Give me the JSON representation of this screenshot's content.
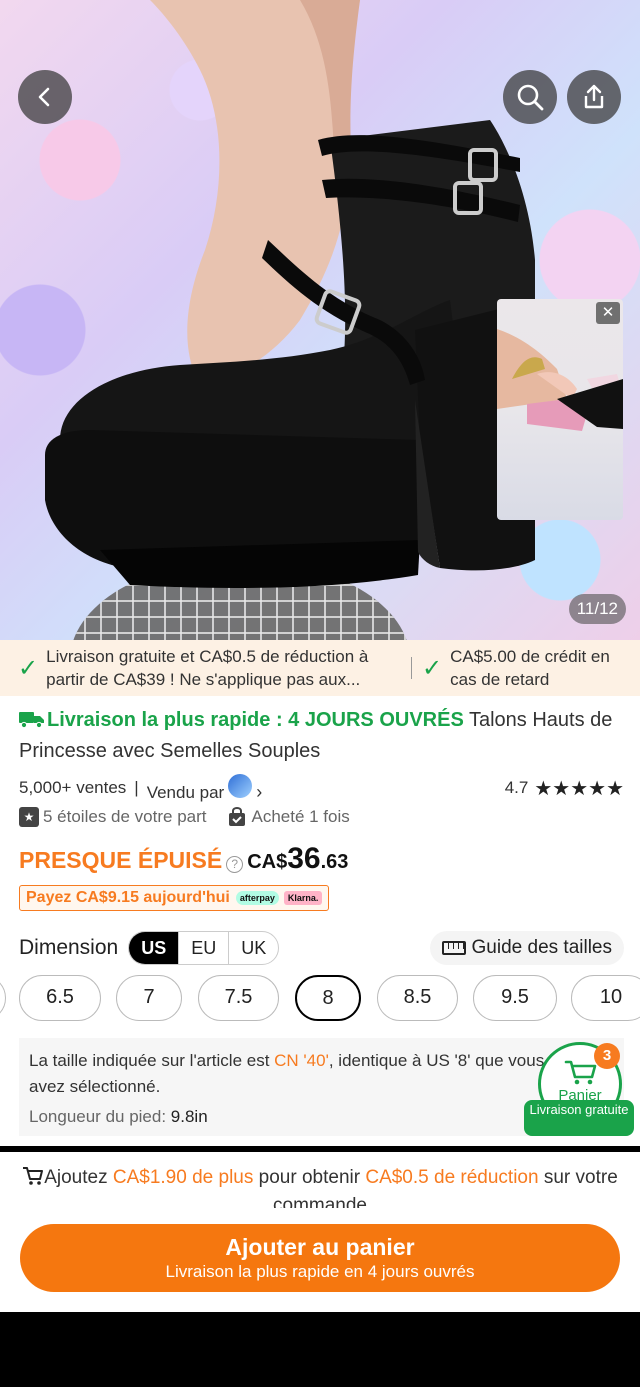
{
  "gallery": {
    "counter": "11/12",
    "icons": {
      "back": "chevron-left-icon",
      "search": "search-icon",
      "share": "share-icon",
      "close": "close-icon"
    }
  },
  "promo": {
    "item1": "Livraison gratuite et CA$0.5 de réduction à partir de CA$39 ! Ne s'applique pas aux...",
    "item2": "CA$5.00 de crédit en cas de retard"
  },
  "product": {
    "fast_delivery": "Livraison la plus rapide : 4 JOURS OUVRÉS",
    "title": " Talons Hauts de Princesse avec Semelles Souples",
    "sales": "5,000+ ventes",
    "sold_by": "Vendu par",
    "rating": "4.7",
    "stars": "★★★★★",
    "badge1": "5 étoiles de votre part",
    "badge2": "Acheté 1 fois"
  },
  "price": {
    "low_stock": "PRESQUE ÉPUISÉ",
    "currency": "CA$",
    "whole": "36",
    "cents": ".63",
    "pay_today": "Payez CA$9.15 aujourd'hui",
    "afterpay": "afterpay",
    "klarna": "Klarna."
  },
  "dimension": {
    "label": "Dimension",
    "systems": [
      "US",
      "EU",
      "UK"
    ],
    "selected_system": "US",
    "guide": "Guide des tailles",
    "sizes": [
      "6.5",
      "7",
      "7.5",
      "8",
      "8.5",
      "9.5",
      "10"
    ],
    "selected_size": "8"
  },
  "size_info": {
    "line1_a": "La taille indiquée sur l'article est ",
    "line1_hl": "CN '40'",
    "line1_b": ", identique à US '8' que vous",
    "line2": "avez sélectionné.",
    "foot_label": "Longueur du pied: ",
    "foot_value": "9.8in"
  },
  "cart_float": {
    "count": "3",
    "label": "Panier",
    "free": "Livraison gratuite"
  },
  "bottom": {
    "add_prefix": "Ajoutez ",
    "add_amount": "CA$1.90 de plus",
    "add_mid": " pour obtenir ",
    "add_discount": "CA$0.5 de réduction",
    "add_suffix": " sur votre commande",
    "button_main": "Ajouter au panier",
    "button_sub": "Livraison la plus rapide en 4 jours ouvrés"
  },
  "colors": {
    "accent": "#f77b20",
    "green": "#1aa34a",
    "button": "#f5770f"
  }
}
